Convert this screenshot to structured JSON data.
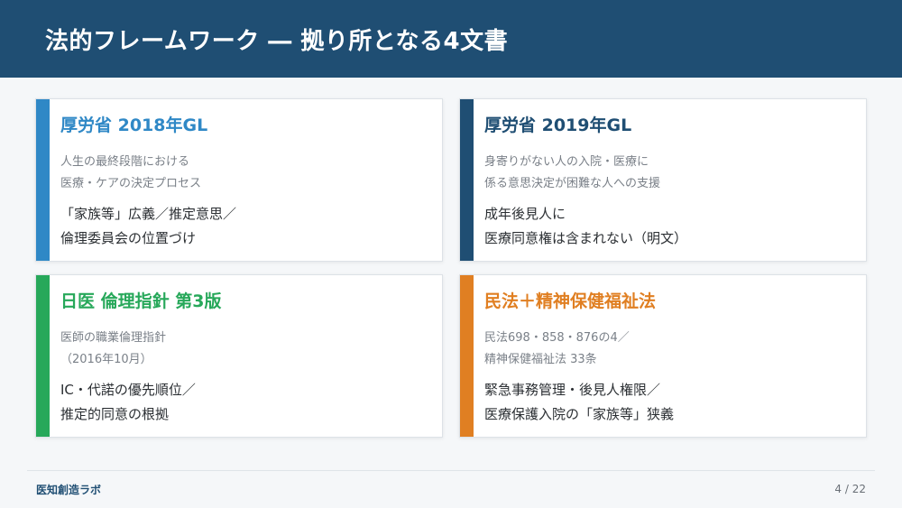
{
  "header": {
    "title": "法的フレームワーク ― 拠り所となる4文書",
    "bg_color": "#1f4e73"
  },
  "cards": [
    {
      "title": "厚労省 2018年GL",
      "accent": "#2f88c6",
      "subtitle_lines": [
        "人生の最終段階における",
        "医療・ケアの決定プロセス"
      ],
      "body_lines": [
        "「家族等」広義／推定意思／",
        "倫理委員会の位置づけ"
      ]
    },
    {
      "title": "厚労省 2019年GL",
      "accent": "#1f4e73",
      "subtitle_lines": [
        "身寄りがない人の入院・医療に",
        "係る意思決定が困難な人への支援"
      ],
      "body_lines": [
        "成年後見人に",
        "医療同意権は含まれない（明文）"
      ]
    },
    {
      "title": "日医 倫理指針 第3版",
      "accent": "#27a85a",
      "subtitle_lines": [
        "医師の職業倫理指針",
        "（2016年10月）"
      ],
      "body_lines": [
        "IC・代諾の優先順位／",
        "推定的同意の根拠"
      ]
    },
    {
      "title": "民法＋精神保健福祉法",
      "accent": "#e07f22",
      "subtitle_lines": [
        "民法698・858・876の4／",
        "精神保健福祉法 33条"
      ],
      "body_lines": [
        "緊急事務管理・後見人権限／",
        "医療保護入院の「家族等」狭義"
      ]
    }
  ],
  "footer": {
    "brand": "医知創造ラボ",
    "page": "4 / 22"
  }
}
